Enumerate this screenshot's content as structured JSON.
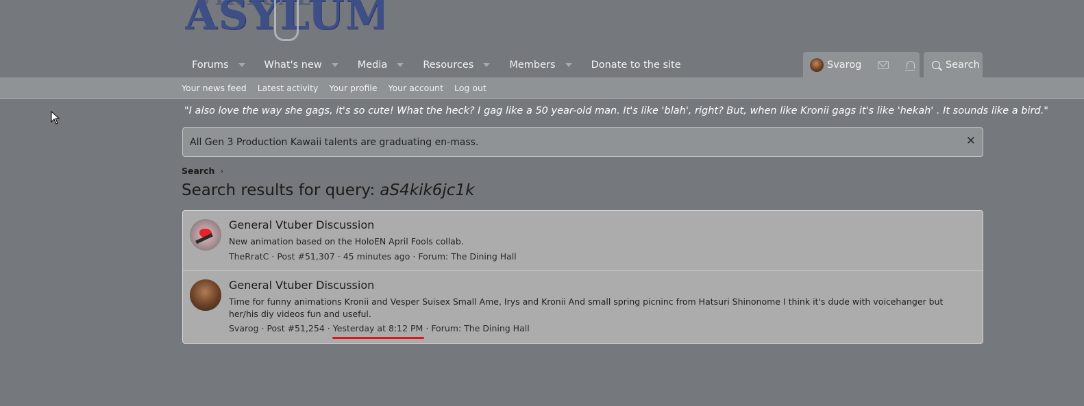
{
  "logo": {
    "text": "ASYLUM",
    "top_text": "VIRTUAL"
  },
  "nav": {
    "items": [
      {
        "label": "Forums",
        "has_dropdown": true
      },
      {
        "label": "What's new",
        "has_dropdown": true
      },
      {
        "label": "Media",
        "has_dropdown": true
      },
      {
        "label": "Resources",
        "has_dropdown": true
      },
      {
        "label": "Members",
        "has_dropdown": true
      },
      {
        "label": "Donate to the site",
        "has_dropdown": false
      }
    ],
    "user_name": "Svarog",
    "search_label": "Search"
  },
  "subnav": {
    "items": [
      "Your news feed",
      "Latest activity",
      "Your profile",
      "Your account",
      "Log out"
    ]
  },
  "quote": "\"I also love the way she gags, it's so cute! What the heck? I gag like a 50 year-old man. It's like 'blah', right? But, when like Kronii gags it's like 'hekah' . It sounds like a bird.\"",
  "notice": {
    "text": "All Gen 3 Production Kawaii talents are graduating en-mass.",
    "close": "✕"
  },
  "breadcrumb": {
    "label": "Search",
    "chevron": "›"
  },
  "page": {
    "title_prefix": "Search results for query: ",
    "query": "aS4kik6jc1k"
  },
  "results": [
    {
      "title": "General Vtuber Discussion",
      "snippet": "New animation based on the HoloEN April Fools collab.",
      "author": "TheRratC",
      "post": "Post #51,307",
      "time": "45 minutes ago",
      "forum": "Forum: The Dining Hall"
    },
    {
      "title": "General Vtuber Discussion",
      "snippet": "Time for funny animations Kronii and Vesper Suisex Small Ame, Irys and Kronii And small spring picninc from Hatsuri Shinonome I think it's dude with voicehanger but her/his diy videos fun and useful.",
      "author": "Svarog",
      "post": "Post #51,254",
      "time": "Yesterday at 8:12 PM",
      "forum": "Forum: The Dining Hall"
    }
  ],
  "meta_separator": "·",
  "colors": {
    "background": "#75787c",
    "nav_active": "#8f9396",
    "highlight_underline": "#e0141e"
  }
}
